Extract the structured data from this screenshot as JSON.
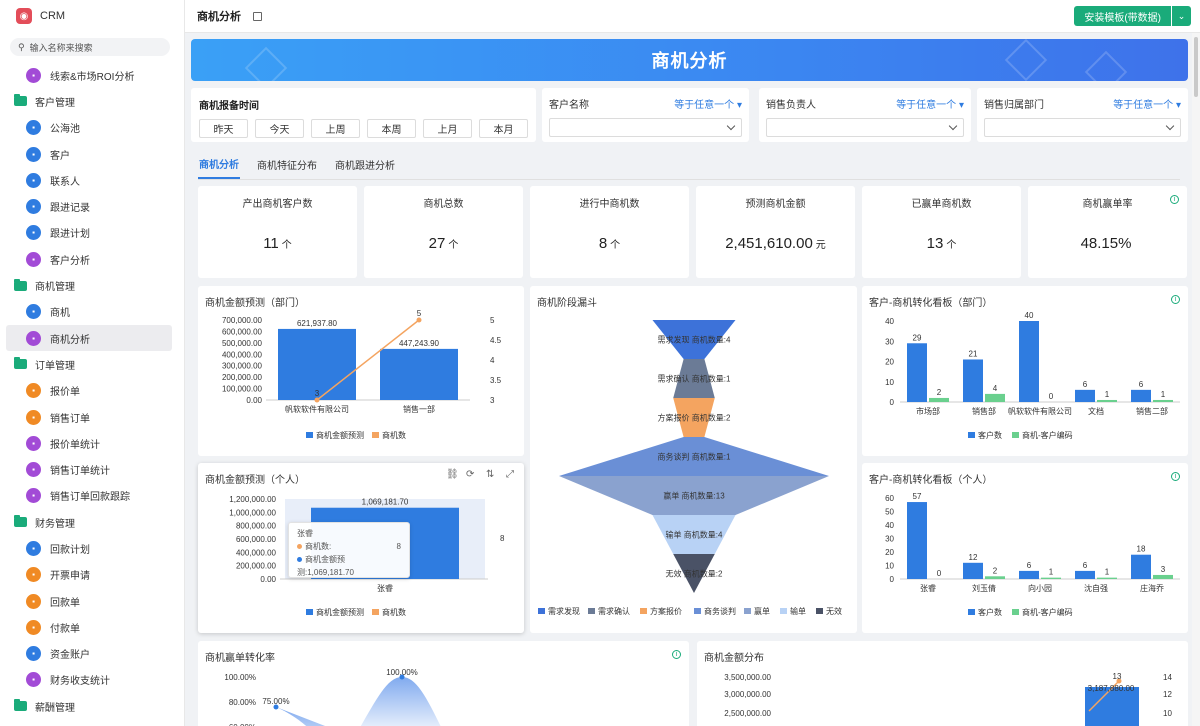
{
  "app": {
    "brand": "CRM",
    "logo": "crm-logo-icon",
    "search_placeholder": "输入名称来搜索"
  },
  "sidebar": {
    "items": [
      {
        "type": "item",
        "label": "线索&市场ROI分析",
        "icon": "chart-icon",
        "color": "#a24bd6"
      },
      {
        "type": "group",
        "label": "客户管理"
      },
      {
        "type": "item",
        "label": "公海池",
        "icon": "users-icon",
        "color": "#2f7ce0"
      },
      {
        "type": "item",
        "label": "客户",
        "icon": "user-icon",
        "color": "#2f7ce0"
      },
      {
        "type": "item",
        "label": "联系人",
        "icon": "contact-icon",
        "color": "#2f7ce0"
      },
      {
        "type": "item",
        "label": "跟进记录",
        "icon": "record-icon",
        "color": "#2f7ce0"
      },
      {
        "type": "item",
        "label": "跟进计划",
        "icon": "plan-icon",
        "color": "#2f7ce0"
      },
      {
        "type": "item",
        "label": "客户分析",
        "icon": "chart-icon",
        "color": "#a24bd6"
      },
      {
        "type": "group",
        "label": "商机管理"
      },
      {
        "type": "item",
        "label": "商机",
        "icon": "opportunity-icon",
        "color": "#2f7ce0"
      },
      {
        "type": "item",
        "label": "商机分析",
        "icon": "chart-icon",
        "color": "#a24bd6",
        "active": true
      },
      {
        "type": "group",
        "label": "订单管理"
      },
      {
        "type": "item",
        "label": "报价单",
        "icon": "quote-icon",
        "color": "#f08a24"
      },
      {
        "type": "item",
        "label": "销售订单",
        "icon": "order-icon",
        "color": "#f08a24"
      },
      {
        "type": "item",
        "label": "报价单统计",
        "icon": "chart-icon",
        "color": "#a24bd6"
      },
      {
        "type": "item",
        "label": "销售订单统计",
        "icon": "chart-icon",
        "color": "#a24bd6"
      },
      {
        "type": "item",
        "label": "销售订单回款跟踪",
        "icon": "chart-icon",
        "color": "#a24bd6"
      },
      {
        "type": "group",
        "label": "财务管理"
      },
      {
        "type": "item",
        "label": "回款计划",
        "icon": "plan-icon",
        "color": "#2f7ce0"
      },
      {
        "type": "item",
        "label": "开票申请",
        "icon": "invoice-icon",
        "color": "#f08a24"
      },
      {
        "type": "item",
        "label": "回款单",
        "icon": "payment-icon",
        "color": "#f08a24"
      },
      {
        "type": "item",
        "label": "付款单",
        "icon": "pay-icon",
        "color": "#f08a24"
      },
      {
        "type": "item",
        "label": "资金账户",
        "icon": "account-icon",
        "color": "#2f7ce0"
      },
      {
        "type": "item",
        "label": "财务收支统计",
        "icon": "chart-icon",
        "color": "#a24bd6"
      },
      {
        "type": "group",
        "label": "薪酬管理"
      }
    ]
  },
  "header": {
    "title": "商机分析",
    "install_label": "安装模板(带数据)"
  },
  "banner": {
    "title": "商机分析"
  },
  "filters": {
    "time": {
      "label": "商机报备时间",
      "buttons": [
        "昨天",
        "今天",
        "上周",
        "本周",
        "上月",
        "本月"
      ]
    },
    "selects": [
      {
        "label": "客户名称",
        "cond": "等于任意一个"
      },
      {
        "label": "销售负责人",
        "cond": "等于任意一个"
      },
      {
        "label": "销售归属部门",
        "cond": "等于任意一个"
      }
    ]
  },
  "tabs": [
    "商机分析",
    "商机特征分布",
    "商机跟进分析"
  ],
  "kpis": [
    {
      "label": "产出商机客户数",
      "value": "11",
      "unit": "个"
    },
    {
      "label": "商机总数",
      "value": "27",
      "unit": "个"
    },
    {
      "label": "进行中商机数",
      "value": "8",
      "unit": "个"
    },
    {
      "label": "预测商机金额",
      "value": "2,451,610.00",
      "unit": "元"
    },
    {
      "label": "已赢单商机数",
      "value": "13",
      "unit": "个"
    },
    {
      "label": "商机赢单率",
      "value": "48.15%",
      "unit": ""
    }
  ],
  "colors": {
    "blue": "#2f7ce0",
    "orange": "#f4a460",
    "green": "#6ad08e",
    "accent": "#1aab7a"
  },
  "chart_data": [
    {
      "id": "dept-forecast",
      "type": "bar",
      "title": "商机金额预测（部门）",
      "categories": [
        "帆软软件有限公司",
        "销售一部"
      ],
      "series": [
        {
          "name": "商机金额预测",
          "values": [
            621937.8,
            447243.9
          ],
          "labels": [
            "621,937.80",
            "447,243.90"
          ]
        },
        {
          "name": "商机数",
          "type": "line",
          "axis": "right",
          "values": [
            3,
            5
          ],
          "labels": [
            "3",
            "5"
          ]
        }
      ],
      "y_ticks": [
        "700,000.00",
        "600,000.00",
        "500,000.00",
        "400,000.00",
        "300,000.00",
        "200,000.00",
        "100,000.00",
        "0.00"
      ],
      "y2_ticks": [
        "5",
        "4.5",
        "4",
        "3.5",
        "3"
      ],
      "ylim": [
        0,
        700000
      ],
      "y2lim": [
        3,
        5
      ]
    },
    {
      "id": "person-forecast",
      "type": "bar",
      "title": "商机金额预测（个人）",
      "categories": [
        "张睿"
      ],
      "series": [
        {
          "name": "商机金额预测",
          "values": [
            1069181.7
          ],
          "labels": [
            "1,069,181.70"
          ]
        },
        {
          "name": "商机数",
          "type": "line",
          "axis": "right",
          "values": [
            8
          ],
          "labels": [
            "8"
          ]
        }
      ],
      "y_ticks": [
        "1,200,000.00",
        "1,000,000.00",
        "800,000.00",
        "600,000.00",
        "400,000.00",
        "200,000.00",
        "0.00"
      ],
      "y2_ticks": [
        "8"
      ],
      "ylim": [
        0,
        1200000
      ],
      "tooltip": {
        "title": "张睿",
        "rows": [
          {
            "name": "商机数:",
            "value": "8"
          },
          {
            "name": "商机金额预测:",
            "value": "1,069,181.70"
          }
        ]
      }
    },
    {
      "id": "funnel",
      "type": "funnel",
      "title": "商机阶段漏斗",
      "stages": [
        {
          "name": "需求发现",
          "count": 4,
          "label": "需求发现 商机数量:4",
          "color": "#3d72d9"
        },
        {
          "name": "需求确认",
          "count": 1,
          "label": "需求确认 商机数量:1",
          "color": "#6b7b96"
        },
        {
          "name": "方案报价",
          "count": 2,
          "label": "方案报价 商机数量:2",
          "color": "#f4a460"
        },
        {
          "name": "商务谈判",
          "count": 1,
          "label": "商务谈判 商机数量:1",
          "color": "#6a8fd6"
        },
        {
          "name": "赢单",
          "count": 13,
          "label": "赢单 商机数量:13",
          "color": "#8aa2cf"
        },
        {
          "name": "输单",
          "count": 4,
          "label": "输单 商机数量:4",
          "color": "#b8d2f5"
        },
        {
          "name": "无效",
          "count": 2,
          "label": "无效 商机数量:2",
          "color": "#4a5266"
        }
      ]
    },
    {
      "id": "dept-board",
      "type": "bar",
      "title": "客户-商机转化看板（部门）",
      "categories": [
        "市场部",
        "销售部",
        "帆软软件有限公司",
        "文档",
        "销售二部"
      ],
      "series": [
        {
          "name": "客户数",
          "values": [
            29,
            21,
            40,
            6,
            6
          ]
        },
        {
          "name": "商机-客户编码",
          "values": [
            2,
            4,
            0,
            1,
            1
          ]
        }
      ],
      "y_ticks": [
        "40",
        "30",
        "20",
        "10",
        "0"
      ],
      "ylim": [
        0,
        40
      ]
    },
    {
      "id": "person-board",
      "type": "bar",
      "title": "客户-商机转化看板（个人）",
      "categories": [
        "张睿",
        "刘玉倩",
        "向小园",
        "沈自强",
        "庄海乔"
      ],
      "series": [
        {
          "name": "客户数",
          "values": [
            57,
            12,
            6,
            6,
            18
          ]
        },
        {
          "name": "商机-客户编码",
          "values": [
            0,
            2,
            1,
            1,
            3
          ]
        }
      ],
      "y_ticks": [
        "60",
        "50",
        "40",
        "30",
        "20",
        "10",
        "0"
      ],
      "ylim": [
        0,
        60
      ]
    },
    {
      "id": "win-rate",
      "type": "area",
      "title": "商机赢单转化率",
      "y_ticks": [
        "100.00%",
        "80.00%",
        "60.00%"
      ],
      "labels": [
        "75.00%",
        "100.00%"
      ]
    },
    {
      "id": "amount-dist",
      "type": "bar",
      "title": "商机金额分布",
      "y_ticks": [
        "3,500,000.00",
        "3,000,000.00",
        "2,500,000.00"
      ],
      "y2_ticks": [
        "14",
        "12",
        "10"
      ],
      "labels": [
        "13",
        "3,187,880.00"
      ]
    }
  ]
}
